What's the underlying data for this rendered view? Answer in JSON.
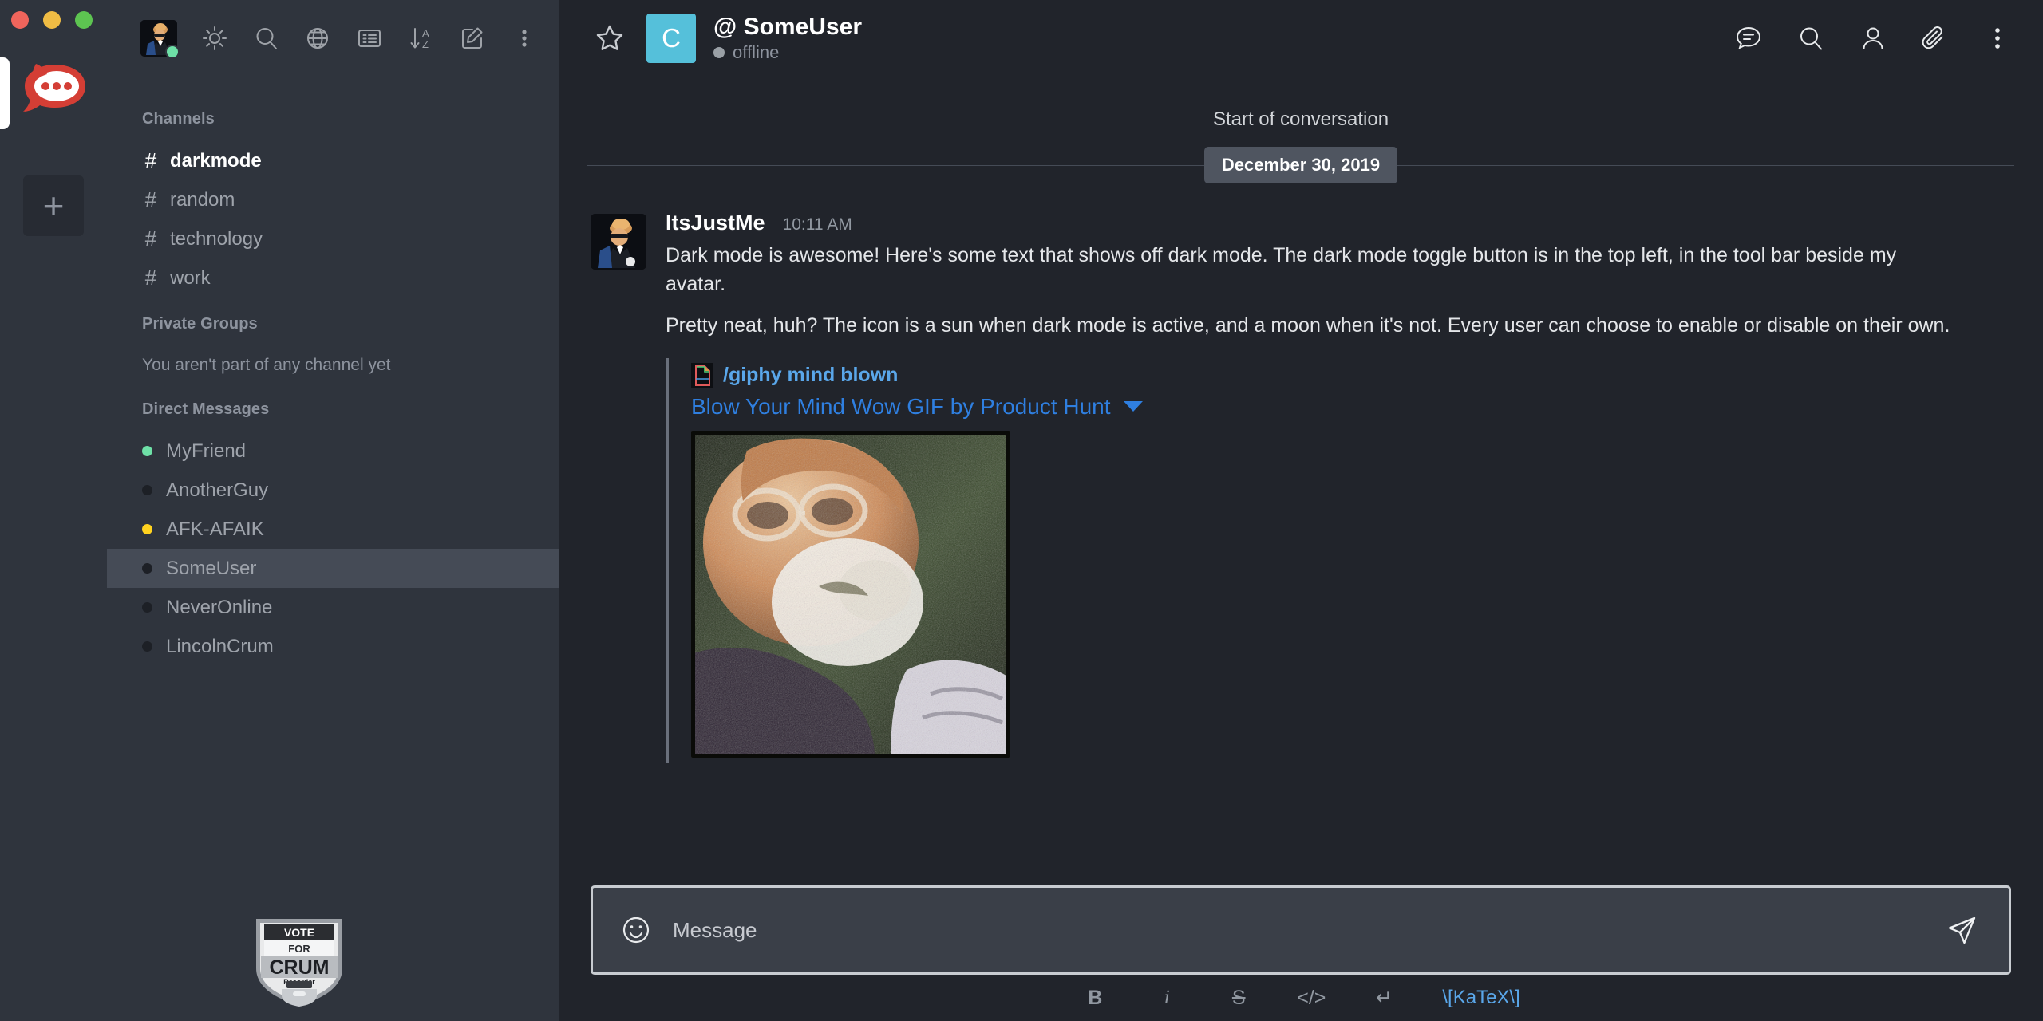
{
  "window": {
    "traffic_lights": [
      "close",
      "minimize",
      "maximize"
    ],
    "logo_name": "rocketchat-logo",
    "add_server_label": "+"
  },
  "sidebar": {
    "toolbar": {
      "avatar_name": "user-avatar",
      "avatar_status": "online",
      "icons": [
        {
          "name": "sun-icon",
          "title": "Toggle dark mode"
        },
        {
          "name": "search-icon",
          "title": "Search"
        },
        {
          "name": "globe-icon",
          "title": "Directory"
        },
        {
          "name": "list-icon",
          "title": "Directory list"
        },
        {
          "name": "sort-az-icon",
          "title": "Sort"
        },
        {
          "name": "pencil-icon",
          "title": "Create new"
        },
        {
          "name": "kebab-menu-icon",
          "title": "Options"
        }
      ]
    },
    "sections": {
      "channels_title": "Channels",
      "private_groups_title": "Private Groups",
      "private_groups_empty": "You aren't part of any channel yet",
      "direct_messages_title": "Direct Messages"
    },
    "channels": [
      {
        "name": "darkmode",
        "active": true
      },
      {
        "name": "random",
        "active": false
      },
      {
        "name": "technology",
        "active": false
      },
      {
        "name": "work",
        "active": false
      }
    ],
    "direct_messages": [
      {
        "name": "MyFriend",
        "status": "online",
        "color": "#6ee0a7",
        "selected": false
      },
      {
        "name": "AnotherGuy",
        "status": "offline",
        "color": "#1d2026",
        "selected": false
      },
      {
        "name": "AFK-AFAIK",
        "status": "away",
        "color": "#ffd21f",
        "selected": false
      },
      {
        "name": "SomeUser",
        "status": "offline",
        "color": "#1d2026",
        "selected": true
      },
      {
        "name": "NeverOnline",
        "status": "offline",
        "color": "#1d2026",
        "selected": false
      },
      {
        "name": "LincolnCrum",
        "status": "offline",
        "color": "#1d2026",
        "selected": false
      }
    ],
    "badge": {
      "line1": "VOTE",
      "line2": "FOR",
      "line3": "CRUM",
      "line4": "Recorder"
    }
  },
  "chat_header": {
    "favorite_icon": "star-icon",
    "avatar_letter": "C",
    "avatar_color": "#55c0da",
    "title": "@ SomeUser",
    "status_text": "offline",
    "status_color": "#9aa0a6",
    "actions": [
      {
        "name": "threads-icon",
        "title": "Threads"
      },
      {
        "name": "search-icon",
        "title": "Search Messages"
      },
      {
        "name": "members-icon",
        "title": "Members"
      },
      {
        "name": "attachment-icon",
        "title": "Files"
      },
      {
        "name": "kebab-menu-icon",
        "title": "Options"
      }
    ]
  },
  "conversation": {
    "start_label": "Start of conversation",
    "date_divider": "December 30, 2019",
    "message": {
      "username": "ItsJustMe",
      "time": "10:11 AM",
      "paragraph1": "Dark mode is awesome! Here's some text that shows off dark mode. The dark mode toggle button is in the top left, in the tool bar beside my avatar.",
      "paragraph2": "Pretty neat, huh? The icon is a sun when dark mode is active, and a moon when it's not. Every user can choose to enable or disable on their own.",
      "attachment": {
        "icon_name": "gif-document-icon",
        "command": "/giphy mind blown",
        "title": "Blow Your Mind Wow GIF by Product Hunt",
        "caret": "dropdown",
        "image_alt": "mind blown gif"
      }
    }
  },
  "composer": {
    "emoji_icon": "smiley-icon",
    "placeholder": "Message",
    "value": "",
    "send_icon": "send-plane-icon",
    "format_buttons": [
      {
        "name": "bold-button",
        "label": "B"
      },
      {
        "name": "italic-button",
        "label": "i"
      },
      {
        "name": "strike-button",
        "label": "S"
      },
      {
        "name": "code-button",
        "label": "</>"
      },
      {
        "name": "multiline-button",
        "label": "↵"
      },
      {
        "name": "katex-button",
        "label": "\\[KaTeX\\]"
      }
    ]
  },
  "colors": {
    "sidebar_bg": "#2f343d",
    "main_bg": "#21242b",
    "selected_row": "#454b56",
    "accent_blue": "#2f7fe0",
    "brand_red": "#d43e35",
    "online_green": "#6ee0a7",
    "away_yellow": "#ffd21f"
  }
}
